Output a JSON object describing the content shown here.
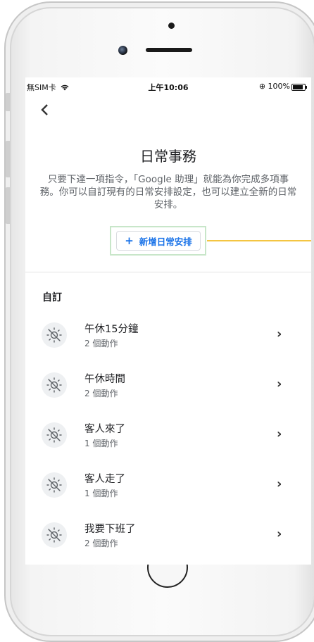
{
  "status_bar": {
    "carrier": "無SIM卡",
    "wifi_icon": "wifi-icon",
    "time": "上午10:06",
    "battery_text": "100%",
    "battery_level": 1.0
  },
  "header": {
    "back_icon": "chevron-left-icon",
    "title": "日常事務"
  },
  "description": "只要下達一項指令，「Google 助理」就能為你完成多項事務。你可以自訂現有的日常安排設定，也可以建立全新的日常安排。",
  "add_button": {
    "icon": "plus-icon",
    "label": "新增日常安排"
  },
  "colors": {
    "accent": "#1a73e8",
    "highlight_border": "#c8e6c9",
    "callout_line": "#f4c542"
  },
  "section_title": "自訂",
  "routines": [
    {
      "name": "午休15分鐘",
      "actions": "2 個動作",
      "icon": "sun-off-icon"
    },
    {
      "name": "午休時間",
      "actions": "2 個動作",
      "icon": "sun-off-icon"
    },
    {
      "name": "客人來了",
      "actions": "1 個動作",
      "icon": "sun-off-icon"
    },
    {
      "name": "客人走了",
      "actions": "1 個動作",
      "icon": "sun-off-icon"
    },
    {
      "name": "我要下班了",
      "actions": "2 個動作",
      "icon": "sun-off-icon"
    }
  ]
}
